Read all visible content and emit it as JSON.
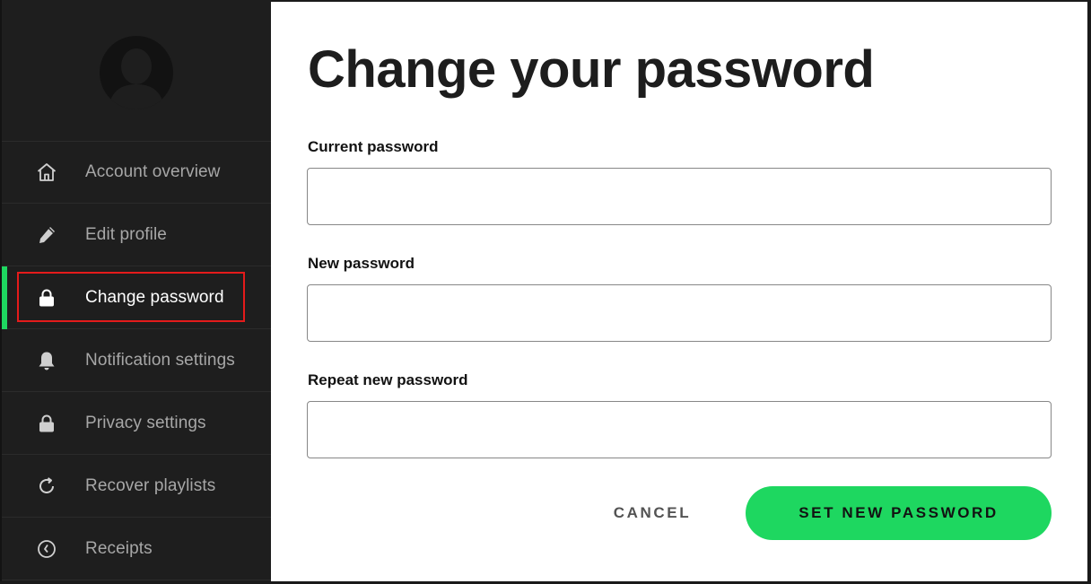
{
  "sidebar": {
    "items": [
      {
        "label": "Account overview",
        "icon": "home-icon",
        "active": false
      },
      {
        "label": "Edit profile",
        "icon": "pencil-icon",
        "active": false
      },
      {
        "label": "Change password",
        "icon": "lock-icon",
        "active": true
      },
      {
        "label": "Notification settings",
        "icon": "bell-icon",
        "active": false
      },
      {
        "label": "Privacy settings",
        "icon": "lock-icon",
        "active": false
      },
      {
        "label": "Recover playlists",
        "icon": "refresh-icon",
        "active": false
      },
      {
        "label": "Receipts",
        "icon": "clock-icon",
        "active": false
      }
    ]
  },
  "main": {
    "title": "Change your password",
    "fields": {
      "current": {
        "label": "Current password",
        "value": "",
        "placeholder": ""
      },
      "new": {
        "label": "New password",
        "value": "",
        "placeholder": ""
      },
      "repeat": {
        "label": "Repeat new password",
        "value": "",
        "placeholder": ""
      }
    },
    "cancel_label": "CANCEL",
    "submit_label": "SET NEW PASSWORD"
  },
  "colors": {
    "sidebar_bg": "#1e1e1e",
    "accent": "#1ed760",
    "highlight": "#e41b1b",
    "text_dark": "#121212",
    "text_muted": "#a7a7a7"
  }
}
